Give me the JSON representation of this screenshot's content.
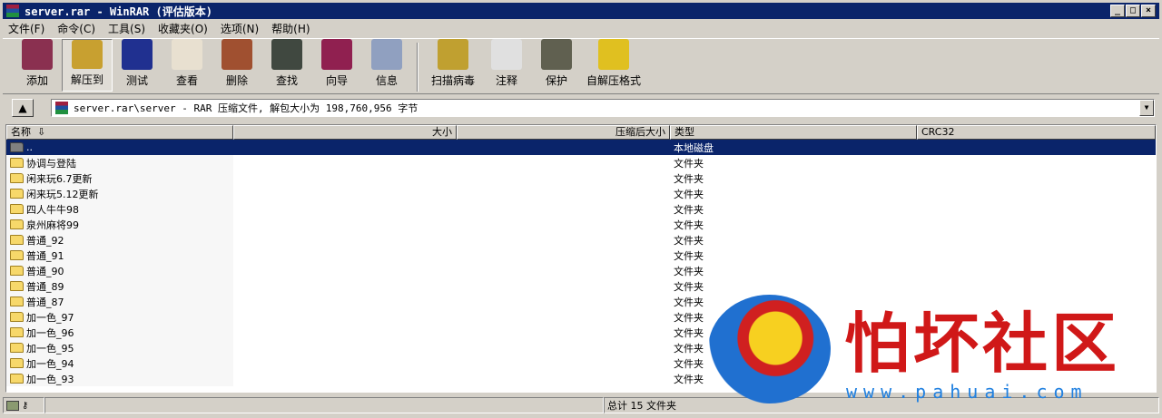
{
  "window": {
    "title": "server.rar - WinRAR (评估版本)",
    "min": "_",
    "max": "□",
    "close": "×"
  },
  "menu": [
    "文件(F)",
    "命令(C)",
    "工具(S)",
    "收藏夹(O)",
    "选项(N)",
    "帮助(H)"
  ],
  "toolbar": [
    {
      "label": "添加",
      "icon": "add-icon",
      "color": "#8a3050"
    },
    {
      "label": "解压到",
      "icon": "extract-icon",
      "color": "#c8a030",
      "pressed": true
    },
    {
      "label": "测试",
      "icon": "test-icon",
      "color": "#203090"
    },
    {
      "label": "查看",
      "icon": "view-icon",
      "color": "#e8e0d0"
    },
    {
      "label": "删除",
      "icon": "delete-icon",
      "color": "#a05030"
    },
    {
      "label": "查找",
      "icon": "find-icon",
      "color": "#404840"
    },
    {
      "label": "向导",
      "icon": "wizard-icon",
      "color": "#902050"
    },
    {
      "label": "信息",
      "icon": "info-icon",
      "color": "#90a0c0"
    },
    {
      "label": "扫描病毒",
      "icon": "virus-scan-icon",
      "color": "#c0a030",
      "sep": true
    },
    {
      "label": "注释",
      "icon": "comment-icon",
      "color": "#e0e0e0"
    },
    {
      "label": "保护",
      "icon": "protect-icon",
      "color": "#606050"
    },
    {
      "label": "自解压格式",
      "icon": "sfx-icon",
      "color": "#e0c020"
    }
  ],
  "address": {
    "path": "server.rar\\server - RAR 压缩文件, 解包大小为 198,760,956 字节"
  },
  "columns": {
    "name": "名称",
    "size": "大小",
    "packed": "压缩后大小",
    "type": "类型",
    "crc": "CRC32",
    "sort_arrow": "⇩"
  },
  "rows": [
    {
      "name": "..",
      "type": "本地磁盘",
      "selected": true
    },
    {
      "name": "协调与登陆",
      "type": "文件夹"
    },
    {
      "name": "闲来玩6.7更新",
      "type": "文件夹"
    },
    {
      "name": "闲来玩5.12更新",
      "type": "文件夹"
    },
    {
      "name": "四人牛牛98",
      "type": "文件夹"
    },
    {
      "name": "泉州麻将99",
      "type": "文件夹"
    },
    {
      "name": "普通_92",
      "type": "文件夹"
    },
    {
      "name": "普通_91",
      "type": "文件夹"
    },
    {
      "name": "普通_90",
      "type": "文件夹"
    },
    {
      "name": "普通_89",
      "type": "文件夹"
    },
    {
      "name": "普通_87",
      "type": "文件夹"
    },
    {
      "name": "加一色_97",
      "type": "文件夹"
    },
    {
      "name": "加一色_96",
      "type": "文件夹"
    },
    {
      "name": "加一色_95",
      "type": "文件夹"
    },
    {
      "name": "加一色_94",
      "type": "文件夹"
    },
    {
      "name": "加一色_93",
      "type": "文件夹"
    }
  ],
  "status": {
    "total": "总计 15 文件夹"
  },
  "watermark": {
    "name": "怕坏社区",
    "url": "www.pahuai.com"
  }
}
